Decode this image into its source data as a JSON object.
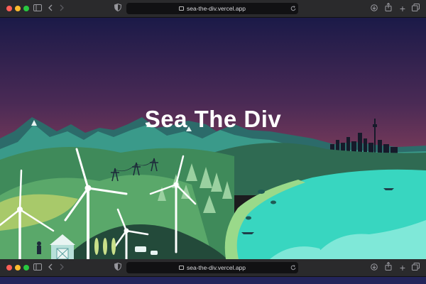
{
  "browser": {
    "url": "sea-the-div.vercel.app",
    "icons": {
      "close": "window-close-dot",
      "minimize": "window-minimize-dot",
      "maximize": "window-maximize-dot",
      "sidebar": "sidebar-icon",
      "back": "back-chevron-icon",
      "forward": "forward-chevron-icon",
      "privacy": "shield-icon",
      "reload": "reload-icon",
      "download": "download-icon",
      "share": "share-icon",
      "new_tab": "plus-icon",
      "tabs": "tabs-overview-icon"
    }
  },
  "hero": {
    "title": "Sea The Div"
  },
  "second_window": {
    "url": "sea-the-div.vercel.app"
  },
  "colors": {
    "sky_top": "#1c1b4a",
    "sky_bottom": "#7a3a5a",
    "sea": "#38d6c0",
    "mountains": "#2f8f82",
    "hills": "#5ba86d",
    "forest": "#2f6a52"
  }
}
